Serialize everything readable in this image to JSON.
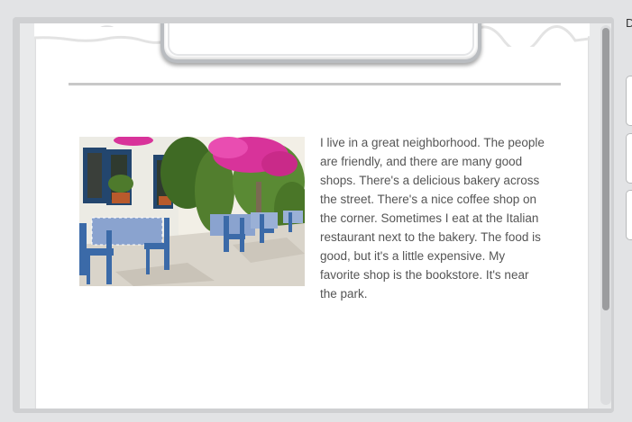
{
  "article": {
    "image": {
      "alt": "Outdoor cafe with blue chairs and checked tablecloths under pink bougainvillea",
      "icon": "photo-icon"
    },
    "text": "I live in a great neighborhood. The people are friendly, and there are many good shops. There's a delicious bakery across the street. There's a nice coffee shop on the corner. Sometimes I eat at the Italian restaurant next to the bakery. The food is good, but it's a little expensive. My favorite shop is the bookstore. It's near the park."
  },
  "edge": {
    "letter": "D"
  },
  "colors": {
    "background": "#e2e3e5",
    "paper": "#ffffff",
    "text": "#555555",
    "divider": "#c8c8c8",
    "scroll_thumb": "#9b9c9e"
  }
}
